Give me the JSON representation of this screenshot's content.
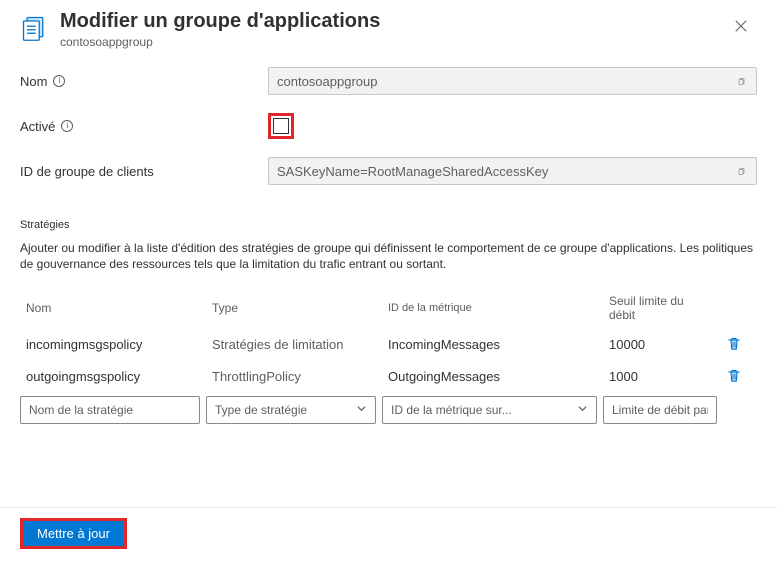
{
  "header": {
    "title": "Modifier un groupe d'applications",
    "subtitle": "contosoappgroup"
  },
  "fields": {
    "name_label": "Nom",
    "name_value": "contosoappgroup",
    "enabled_label": "Activé",
    "client_group_label": "ID de groupe de clients",
    "client_group_value": "SASKeyName=RootManageSharedAccessKey"
  },
  "strategies": {
    "section_title": "Stratégies",
    "description": "Ajouter ou modifier à la liste d'édition des stratégies de groupe qui définissent le comportement de ce groupe d'applications. Les politiques de gouvernance des ressources tels que la limitation du trafic entrant ou sortant.",
    "headers": {
      "name": "Nom",
      "type": "Type",
      "metric_id": "ID de la métrique",
      "threshold": "Seuil limite du débit"
    },
    "rows": [
      {
        "name": "incomingmsgspolicy",
        "type": "Stratégies de limitation",
        "metric_id": "IncomingMessages",
        "threshold": "10000"
      },
      {
        "name": "outgoingmsgspolicy",
        "type": "ThrottlingPolicy",
        "metric_id": "OutgoingMessages",
        "threshold": "1000"
      }
    ],
    "placeholders": {
      "name": "Nom de la stratégie",
      "type": "Type de stratégie",
      "metric_id": "ID de la métrique sur...",
      "threshold": "Limite de débit par seconde"
    }
  },
  "footer": {
    "submit": "Mettre à jour"
  }
}
